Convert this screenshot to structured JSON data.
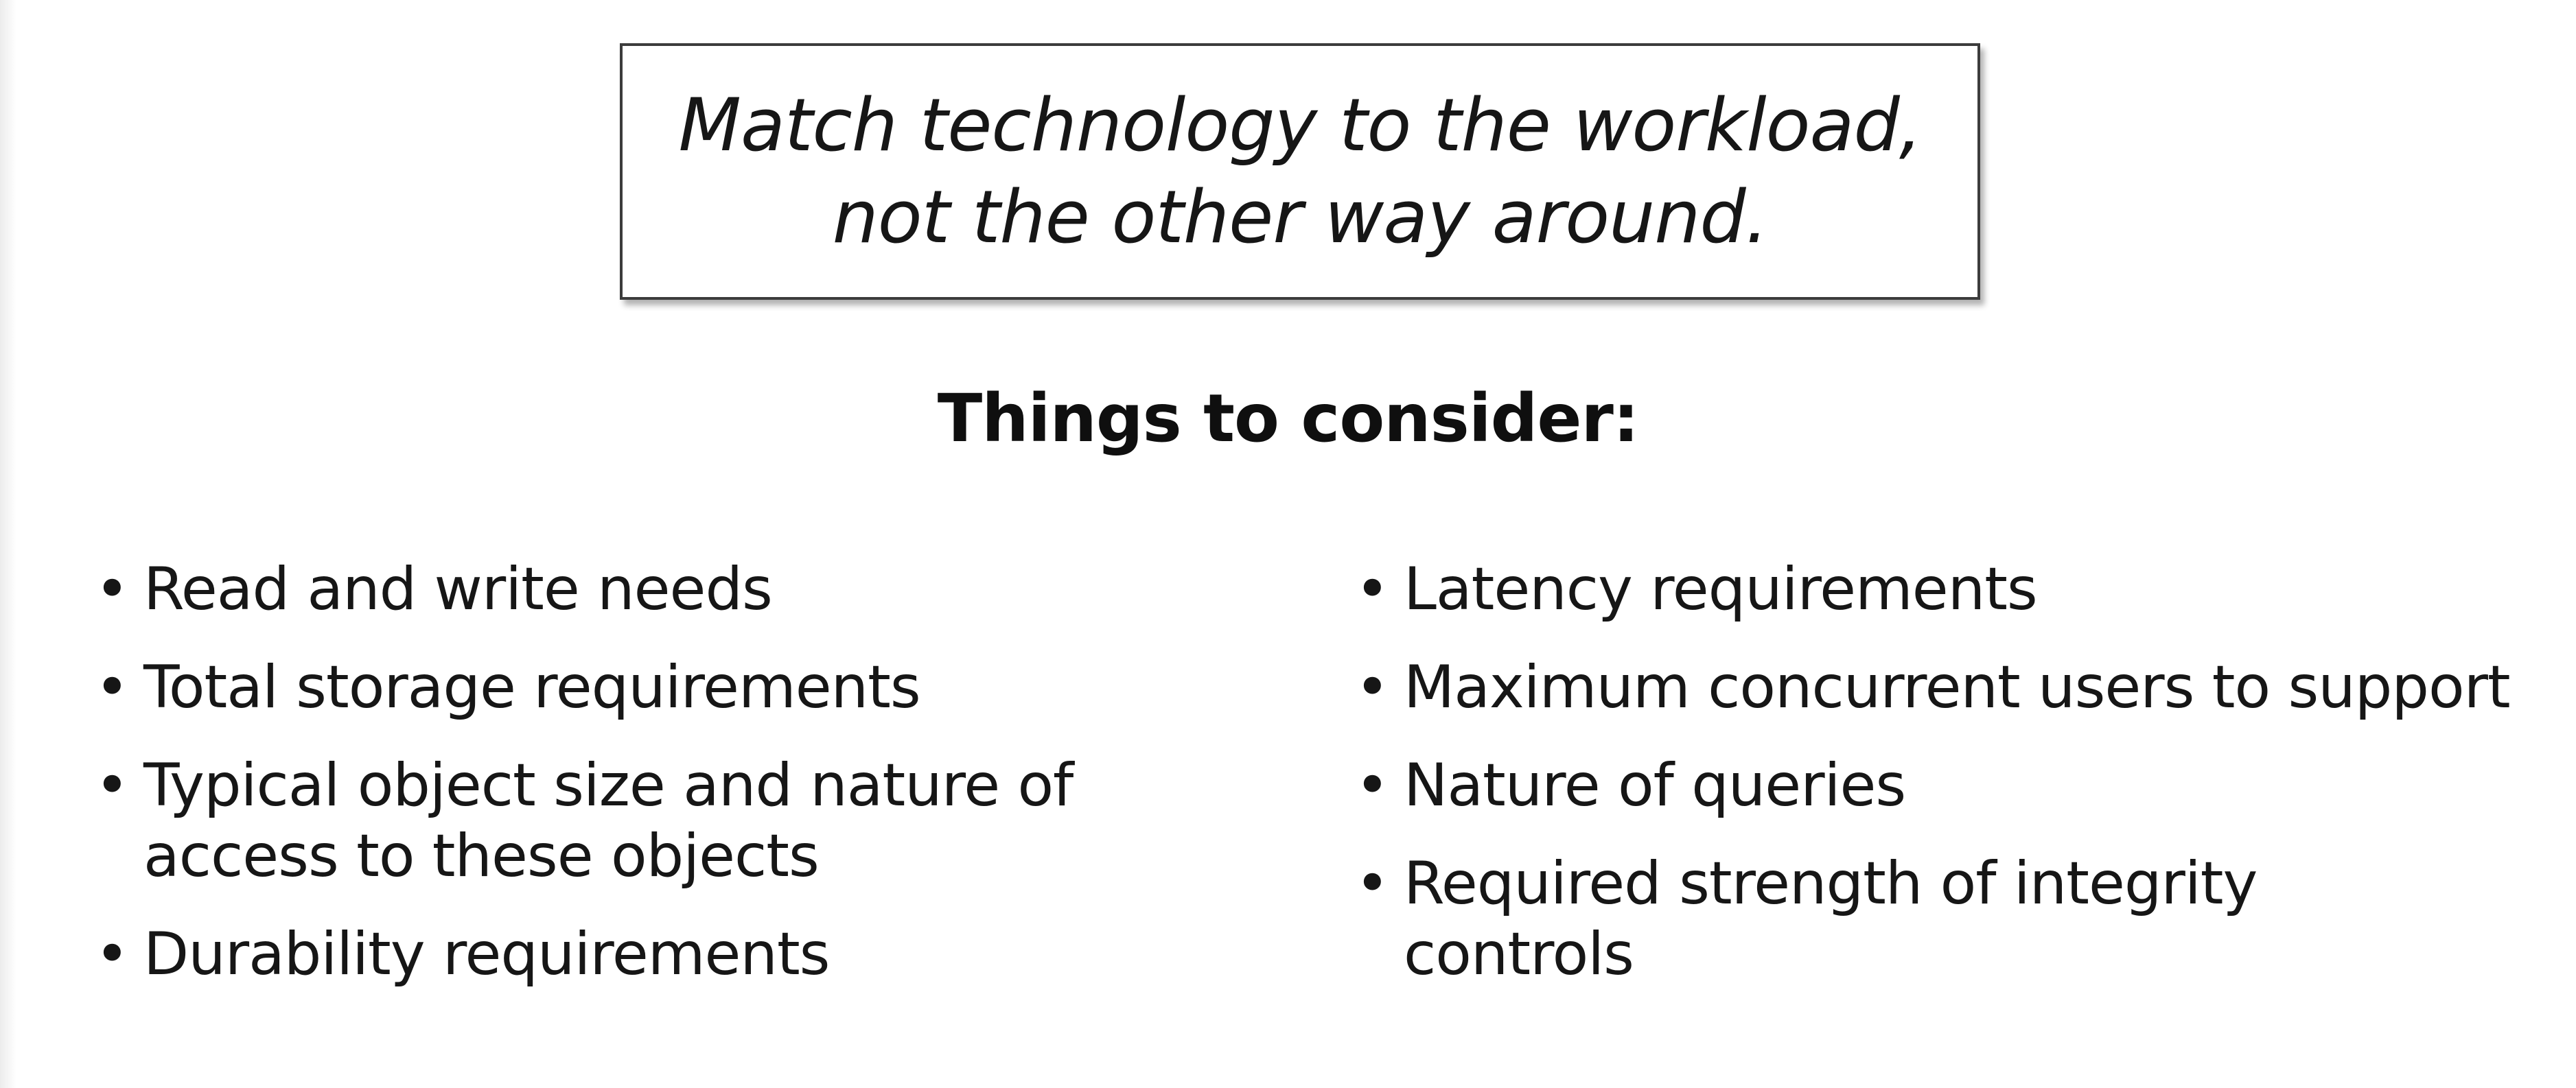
{
  "quote": {
    "line1": "Match technology to the workload,",
    "line2": "not the other way around."
  },
  "heading": "Things to consider:",
  "bullet_glyph": "•",
  "left_items": [
    {
      "lines": [
        "Read and write needs"
      ]
    },
    {
      "lines": [
        "Total storage requirements"
      ]
    },
    {
      "lines": [
        "Typical object size and nature of",
        "access to these objects"
      ]
    },
    {
      "lines": [
        "Durability requirements"
      ]
    }
  ],
  "right_items": [
    {
      "lines": [
        "Latency requirements"
      ]
    },
    {
      "lines": [
        "Maximum concurrent users to support"
      ]
    },
    {
      "lines": [
        "Nature of queries"
      ]
    },
    {
      "lines": [
        "Required strength of integrity",
        "controls"
      ]
    }
  ]
}
